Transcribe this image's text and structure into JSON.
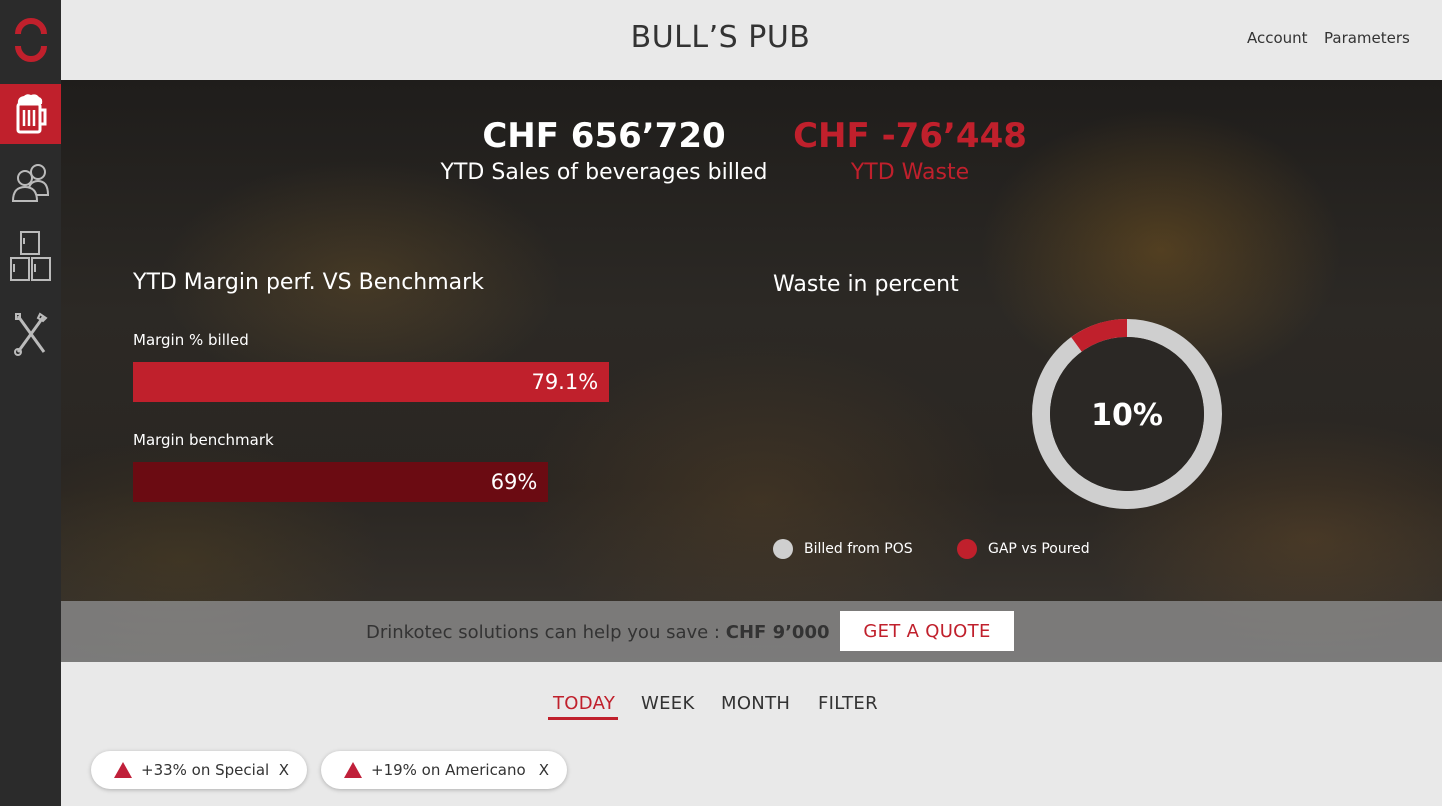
{
  "header": {
    "title": "BULL’S PUB",
    "account_label": "Account",
    "parameters_label": "Parameters"
  },
  "sidebar": {
    "items": [
      {
        "icon": "beer-mug-icon",
        "active": true
      },
      {
        "icon": "users-icon",
        "active": false
      },
      {
        "icon": "fridge-icon",
        "active": false
      },
      {
        "icon": "tools-icon",
        "active": false
      }
    ]
  },
  "kpis": {
    "sales": {
      "value": "CHF 656’720",
      "label": "YTD Sales of beverages billed"
    },
    "waste": {
      "value": "CHF -76’448",
      "label": "YTD Waste"
    }
  },
  "margin": {
    "title": "YTD Margin perf. VS Benchmark",
    "billed": {
      "label": "Margin % billed",
      "value_text": "79.1%",
      "value": 79.1
    },
    "benchmark": {
      "label": "Margin benchmark",
      "value_text": "69%",
      "value": 69
    }
  },
  "waste_chart": {
    "title": "Waste in percent",
    "center_label": "10%",
    "gap_fraction": 0.1,
    "legend": [
      {
        "label": "Billed from POS",
        "color": "#cfcfcf"
      },
      {
        "label": "GAP vs Poured",
        "color": "#c0202c"
      }
    ]
  },
  "promo": {
    "text": "Drinkotec solutions can help you save :",
    "amount": "CHF 9’000",
    "button_label": "GET A QUOTE"
  },
  "tabs": [
    {
      "label": "TODAY",
      "active": true
    },
    {
      "label": "WEEK",
      "active": false
    },
    {
      "label": "MONTH",
      "active": false
    },
    {
      "label": "FILTER",
      "active": false
    }
  ],
  "chips": [
    {
      "label": "+33% on Special",
      "close": "X"
    },
    {
      "label": "+19% on Americano",
      "close": "X"
    }
  ],
  "colors": {
    "accent": "#c0202c",
    "benchmark_bar": "#6b0b12",
    "sidebar": "#2b2b2b"
  }
}
